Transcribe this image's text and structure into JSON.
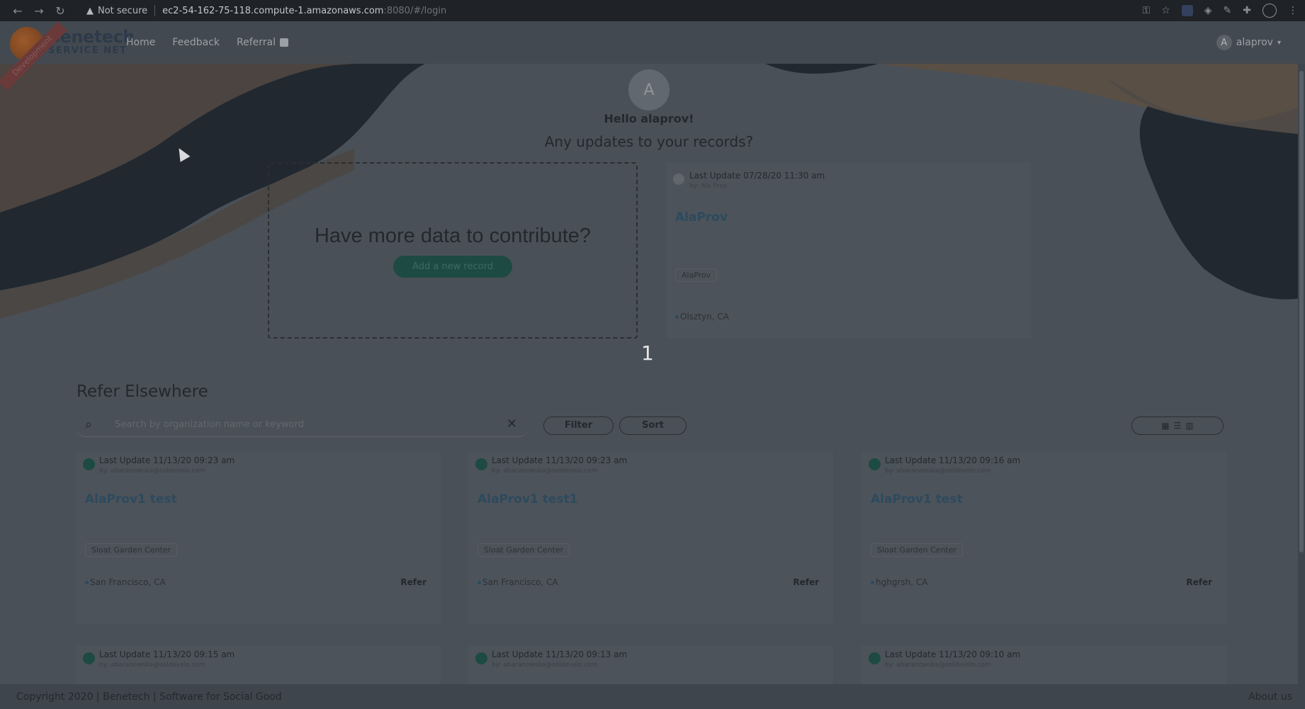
{
  "browser": {
    "not_secure": "Not secure",
    "url_host": "ec2-54-162-75-118.compute-1.amazonaws.com",
    "url_path": ":8080/#/login"
  },
  "app": {
    "brand_line1": "benetech",
    "brand_line2": "SERVICE NET",
    "ribbon": "Development",
    "nav": {
      "home": "Home",
      "feedback": "Feedback",
      "referral": "Referral"
    },
    "user": {
      "initial": "A",
      "name": "alaprov"
    }
  },
  "hero": {
    "avatar_initial": "A",
    "greeting": "Hello alaprov!",
    "subtitle": "Any updates to your records?",
    "contribute_question": "Have more data to contribute?",
    "add_record_label": "Add a new record",
    "my_record": {
      "last_update": "Last Update 07/28/20 11:30 am",
      "by": "by: Ala Prov",
      "name": "AlaProv",
      "tag": "AlaProv",
      "location": "Olsztyn, CA"
    },
    "page_number": "1"
  },
  "refer": {
    "title": "Refer Elsewhere",
    "search_placeholder": "Search by organization name or keyword",
    "filter_label": "Filter",
    "sort_label": "Sort",
    "refer_label": "Refer",
    "cards": [
      {
        "last_update": "Last Update 11/13/20 09:23 am",
        "by": "by: abaranowska@soldevelo.com",
        "name": "AlaProv1 test",
        "tag": "Sloat Garden Center",
        "location": "San Francisco, CA"
      },
      {
        "last_update": "Last Update 11/13/20 09:23 am",
        "by": "by: abaranowska@soldevelo.com",
        "name": "AlaProv1 test1",
        "tag": "Sloat Garden Center",
        "location": "San Francisco, CA"
      },
      {
        "last_update": "Last Update 11/13/20 09:16 am",
        "by": "by: abaranowska@soldevelo.com",
        "name": "AlaProv1 test",
        "tag": "Sloat Garden Center",
        "location": "hghgrsh, CA"
      },
      {
        "last_update": "Last Update 11/13/20 09:15 am",
        "by": "by: abaranowska@soldevelo.com"
      },
      {
        "last_update": "Last Update 11/13/20 09:13 am",
        "by": "by: abaranowska@soldevelo.com"
      },
      {
        "last_update": "Last Update 11/13/20 09:10 am",
        "by": "by: abaranowska@soldevelo.com"
      }
    ]
  },
  "footer": {
    "copyright": "Copyright 2020 | Benetech | Software for Social Good",
    "about": "About us"
  }
}
